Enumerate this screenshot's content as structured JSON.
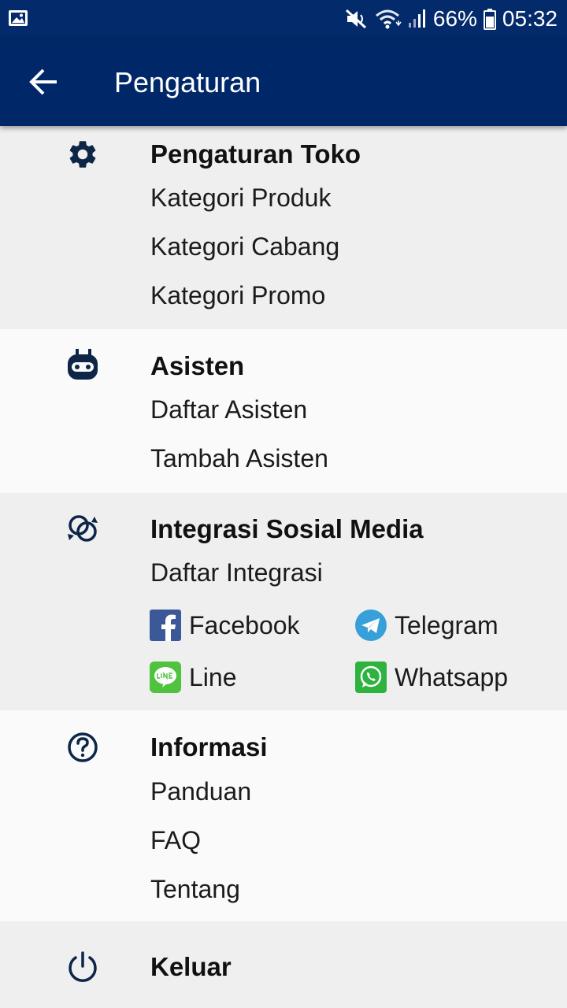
{
  "status_bar": {
    "battery": "66%",
    "time": "05:32"
  },
  "app_bar": {
    "title": "Pengaturan"
  },
  "sections": {
    "toko": {
      "title": "Pengaturan Toko",
      "items": [
        "Kategori Produk",
        "Kategori Cabang",
        "Kategori Promo"
      ]
    },
    "asisten": {
      "title": "Asisten",
      "items": [
        "Daftar Asisten",
        "Tambah Asisten"
      ]
    },
    "sosial": {
      "title": "Integrasi Sosial Media",
      "items": [
        "Daftar Integrasi"
      ],
      "platforms": [
        "Facebook",
        "Telegram",
        "Line",
        "Whatsapp"
      ]
    },
    "informasi": {
      "title": "Informasi",
      "items": [
        "Panduan",
        "FAQ",
        "Tentang"
      ]
    },
    "keluar": {
      "title": "Keluar"
    }
  },
  "colors": {
    "status_bar": "#032a6a",
    "app_bar": "#002868",
    "icon": "#0d2547",
    "facebook": "#3b5998",
    "telegram": "#37a0d8",
    "line": "#4fc23e",
    "whatsapp": "#2eb33f"
  }
}
